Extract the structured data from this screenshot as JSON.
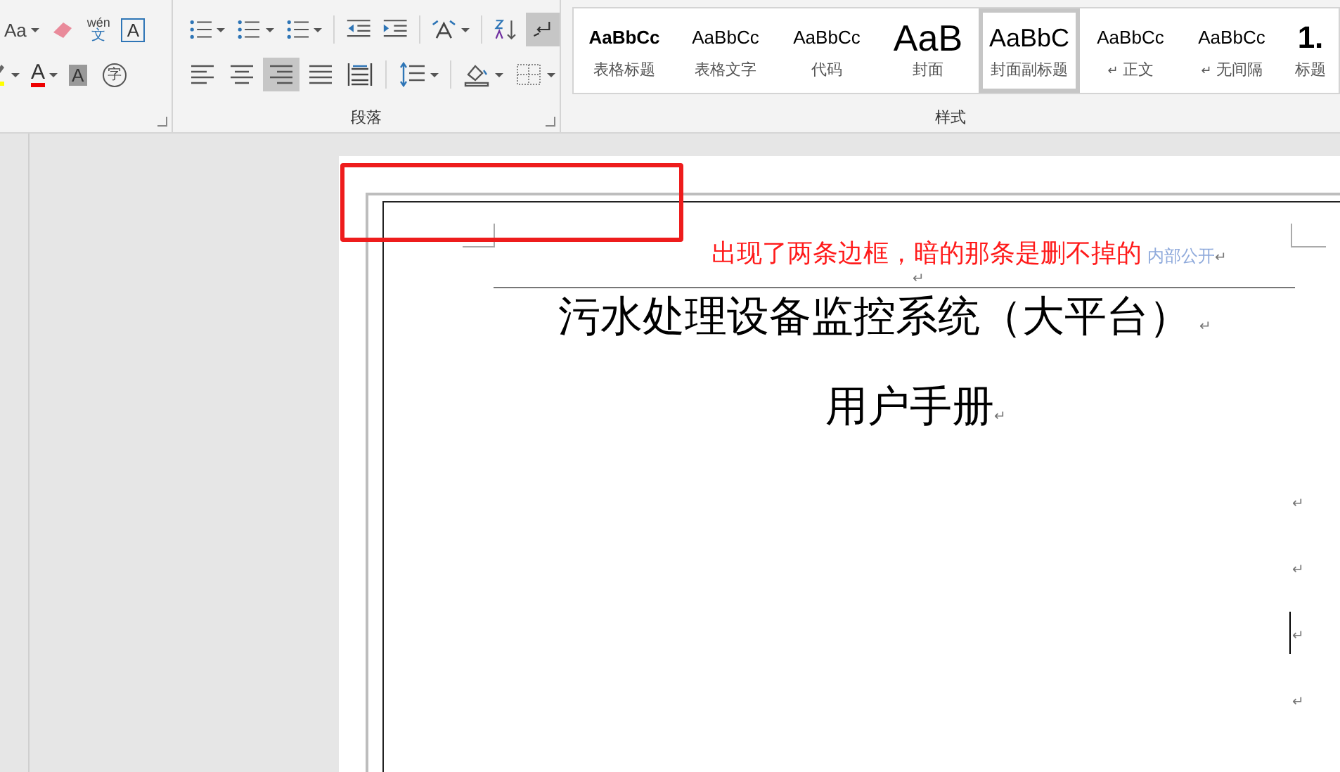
{
  "ribbon": {
    "font_group": {
      "rows": [
        [
          {
            "kind": "case",
            "label": "Aa",
            "dropdown": true,
            "selected": false
          },
          {
            "kind": "eraser",
            "dropdown": false,
            "selected": false
          },
          {
            "kind": "phonetic",
            "label": "wén",
            "sub": "文",
            "dropdown": false,
            "selected": false
          },
          {
            "kind": "boxed",
            "label": "A",
            "dropdown": false,
            "selected": false
          }
        ],
        [
          {
            "kind": "highlight",
            "dropdown": true,
            "selected": false
          },
          {
            "kind": "fontcolor",
            "label": "A",
            "dropdown": true,
            "selected": false
          },
          {
            "kind": "shaded",
            "label": "A",
            "dropdown": false,
            "selected": false
          },
          {
            "kind": "enclosed",
            "label": "字",
            "dropdown": false,
            "selected": false
          }
        ]
      ]
    },
    "paragraph_group": {
      "label": "段落",
      "rows": [
        [
          {
            "kind": "bullets",
            "dropdown": true,
            "selected": false
          },
          {
            "kind": "numbering",
            "dropdown": true,
            "selected": false
          },
          {
            "kind": "multilevel",
            "dropdown": true,
            "selected": false
          },
          {
            "kind": "separator"
          },
          {
            "kind": "outdent",
            "dropdown": false,
            "selected": false
          },
          {
            "kind": "indent",
            "dropdown": false,
            "selected": false
          },
          {
            "kind": "separator"
          },
          {
            "kind": "asianlayout",
            "dropdown": true,
            "selected": false
          },
          {
            "kind": "separator"
          },
          {
            "kind": "sort",
            "dropdown": false,
            "selected": false
          },
          {
            "kind": "marks",
            "dropdown": false,
            "selected": true
          }
        ],
        [
          {
            "kind": "alignleft",
            "dropdown": false,
            "selected": false
          },
          {
            "kind": "center",
            "dropdown": false,
            "selected": false
          },
          {
            "kind": "alignright",
            "dropdown": false,
            "selected": true
          },
          {
            "kind": "justify",
            "dropdown": false,
            "selected": false
          },
          {
            "kind": "distribute",
            "dropdown": false,
            "selected": false
          },
          {
            "kind": "separator"
          },
          {
            "kind": "spacing",
            "dropdown": true,
            "selected": false
          },
          {
            "kind": "separator"
          },
          {
            "kind": "shading",
            "dropdown": true,
            "selected": false
          },
          {
            "kind": "borders",
            "dropdown": true,
            "selected": false
          }
        ]
      ]
    },
    "styles_group": {
      "label": "样式",
      "items": [
        {
          "preview": "AaBbCc",
          "kind": "bold",
          "label": "表格标题",
          "selected": false
        },
        {
          "preview": "AaBbCc",
          "kind": "normal",
          "label": "表格文字",
          "selected": false
        },
        {
          "preview": "AaBbCc",
          "kind": "normal",
          "label": "代码",
          "selected": false
        },
        {
          "preview": "AaB",
          "kind": "large",
          "label": "封面",
          "selected": false
        },
        {
          "preview": "AaBbC",
          "kind": "medium",
          "label": "封面副标题",
          "selected": true
        },
        {
          "preview": "AaBbCc",
          "kind": "normal",
          "mark": "↵",
          "label": "正文",
          "selected": false
        },
        {
          "preview": "AaBbCc",
          "kind": "normal",
          "mark": "↵",
          "label": "无间隔",
          "selected": false
        },
        {
          "preview": "1.",
          "kind": "number",
          "label": "标题",
          "selected": false
        }
      ]
    }
  },
  "document": {
    "annotation": "出现了两条边框，暗的那条是删不掉的",
    "header_text": "内部公开",
    "header_mark": "↵",
    "header_para_mark": "↵",
    "title": "污水处理设备监控系统（大平台）",
    "title_mark": "↵",
    "subtitle": "用户手册",
    "subtitle_mark": "↵",
    "empty_paragraphs": [
      {
        "mark": "↵",
        "cursor": false
      },
      {
        "mark": "↵",
        "cursor": false
      },
      {
        "mark": "↵",
        "cursor": true
      },
      {
        "mark": "↵",
        "cursor": false
      }
    ]
  }
}
